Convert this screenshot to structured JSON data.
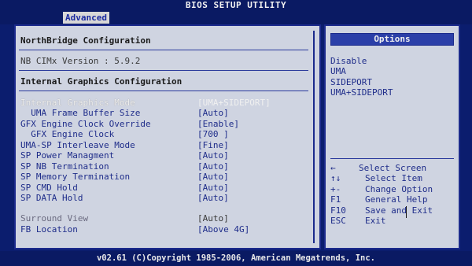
{
  "title": "BIOS SETUP UTILITY",
  "tabs": [
    {
      "label": "Advanced",
      "active": true
    }
  ],
  "main": {
    "header": "NorthBridge Configuration",
    "version_line": "NB CIMx Version : 5.9.2",
    "subheader": "Internal Graphics Configuration",
    "items": [
      {
        "label": "Internal Graphics Mode",
        "value": "[UMA+SIDEPORT]"
      },
      {
        "label": "  UMA Frame Buffer Size",
        "value": "[Auto]"
      },
      {
        "label": "GFX Engine Clock Override",
        "value": "[Enable]"
      },
      {
        "label": "  GFX Engine Clock",
        "value": "[700 ]"
      },
      {
        "label": "UMA-SP Interleave Mode",
        "value": "[Fine]"
      },
      {
        "label": "SP Power Managment",
        "value": "[Auto]"
      },
      {
        "label": "SP NB Termination",
        "value": "[Auto]"
      },
      {
        "label": "SP Memory Termination",
        "value": "[Auto]"
      },
      {
        "label": "SP CMD Hold",
        "value": "[Auto]"
      },
      {
        "label": "SP DATA Hold",
        "value": "[Auto]"
      },
      {
        "label": "Surround View",
        "value": "[Auto]"
      },
      {
        "label": "FB Location",
        "value": "[Above 4G]"
      }
    ]
  },
  "help": {
    "header": "Options",
    "options": [
      "Disable",
      "UMA",
      "SIDEPORT",
      "UMA+SIDEPORT"
    ],
    "keys": [
      {
        "key": "←",
        "desc": "Select Screen"
      },
      {
        "key": "↑↓",
        "desc": "Select Item"
      },
      {
        "key": "+-",
        "desc": "Change Option"
      },
      {
        "key": "F1",
        "desc": "General Help"
      },
      {
        "key": "F10",
        "desc": "Save and Exit"
      },
      {
        "key": "ESC",
        "desc": "Exit"
      }
    ]
  },
  "footer": "v02.61 (C)Copyright 1985-2006, American Megatrends, Inc."
}
